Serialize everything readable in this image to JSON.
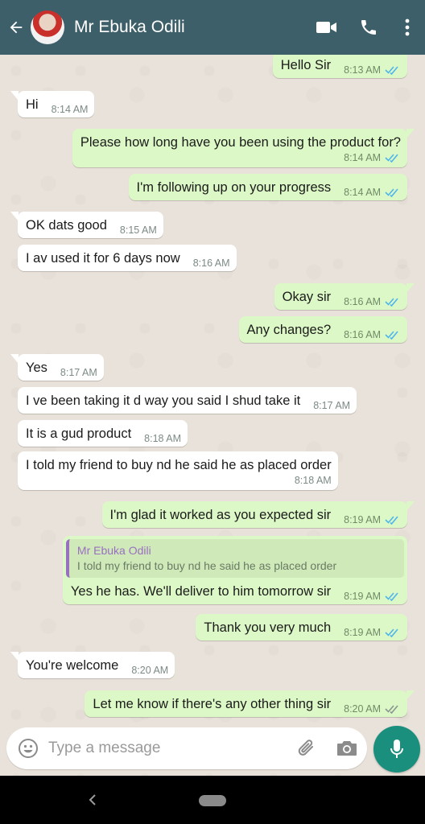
{
  "header": {
    "contact_name": "Mr Ebuka Odili"
  },
  "icons": {
    "back": "arrow-left-icon",
    "video": "video-call-icon",
    "call": "phone-icon",
    "menu": "more-vert-icon",
    "emoji": "emoji-icon",
    "attach": "paperclip-icon",
    "camera": "camera-icon",
    "mic": "microphone-icon"
  },
  "colors": {
    "header": "#3d5f69",
    "outgoing_bubble": "#dcf8c6",
    "incoming_bubble": "#ffffff",
    "read_tick": "#4fb6ec",
    "fab": "#1a8f7e"
  },
  "messages": [
    {
      "dir": "out",
      "text": "Hello Sir",
      "time": "8:13 AM",
      "status": "read"
    },
    {
      "dir": "in",
      "text": "Hi",
      "time": "8:14 AM"
    },
    {
      "dir": "out",
      "text": "Please how long have you been using the product for?",
      "time": "8:14 AM",
      "status": "read"
    },
    {
      "dir": "out",
      "text": "I'm following up on your progress",
      "time": "8:14 AM",
      "status": "read"
    },
    {
      "dir": "in",
      "text": "OK dats good",
      "time": "8:15 AM"
    },
    {
      "dir": "in",
      "text": "I av used it for 6 days now",
      "time": "8:16 AM"
    },
    {
      "dir": "out",
      "text": "Okay sir",
      "time": "8:16 AM",
      "status": "read"
    },
    {
      "dir": "out",
      "text": "Any changes?",
      "time": "8:16 AM",
      "status": "read"
    },
    {
      "dir": "in",
      "text": "Yes",
      "time": "8:17 AM"
    },
    {
      "dir": "in",
      "text": "I ve been taking it d way you said I shud take it",
      "time": "8:17 AM"
    },
    {
      "dir": "in",
      "text": "It is a gud product",
      "time": "8:18 AM"
    },
    {
      "dir": "in",
      "text": "I told my friend to buy nd he said he as placed order",
      "time": "8:18 AM"
    },
    {
      "dir": "out",
      "text": "I'm glad it worked as you expected sir",
      "time": "8:19 AM",
      "status": "read"
    },
    {
      "dir": "out",
      "text": "Yes he has. We'll deliver to him tomorrow sir",
      "time": "8:19 AM",
      "status": "read",
      "quote": {
        "name": "Mr Ebuka Odili",
        "text": "I told my friend to buy nd he said he as placed order"
      }
    },
    {
      "dir": "out",
      "text": "Thank you very much",
      "time": "8:19 AM",
      "status": "read"
    },
    {
      "dir": "in",
      "text": "You're welcome",
      "time": "8:20 AM"
    },
    {
      "dir": "out",
      "text": "Let me know if there's any other thing sir",
      "time": "8:20 AM",
      "status": "delivered"
    }
  ],
  "input": {
    "placeholder": "Type a message"
  }
}
